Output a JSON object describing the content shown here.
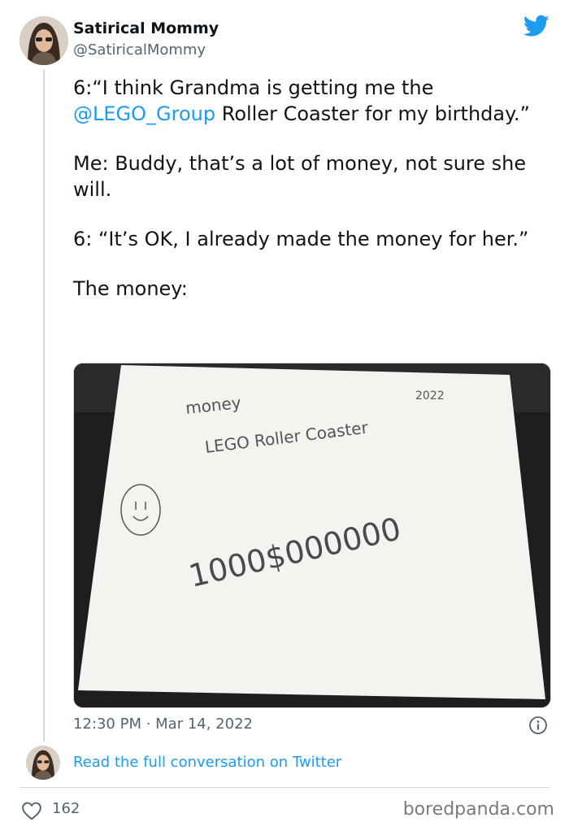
{
  "author": {
    "name": "Satirical Mommy",
    "handle": "@SatiricalMommy"
  },
  "tweet": {
    "p1_prefix": "6:“I think Grandma is getting me the ",
    "p1_mention": "@LEGO_Group",
    "p1_suffix": " Roller Coaster for my birthday.”",
    "p2": "Me:  Buddy, that’s a lot of money, not sure she will.",
    "p3": "6: “It’s OK, I already made the money for her.”",
    "p4": "The money:"
  },
  "photo": {
    "text_money": "money",
    "text_year": "2022",
    "text_product": "LEGO Roller Coaster",
    "text_amount": "1000$000000"
  },
  "meta": {
    "timestamp": "12:30 PM · Mar 14, 2022",
    "read_link": "Read the full conversation on Twitter",
    "like_count": "162",
    "watermark": "boredpanda.com"
  },
  "colors": {
    "accent": "#1d9bf0",
    "text": "#0f1419",
    "muted": "#536471"
  },
  "icons": {
    "brand": "twitter-bird-icon",
    "info": "info-icon",
    "like": "heart-icon"
  }
}
